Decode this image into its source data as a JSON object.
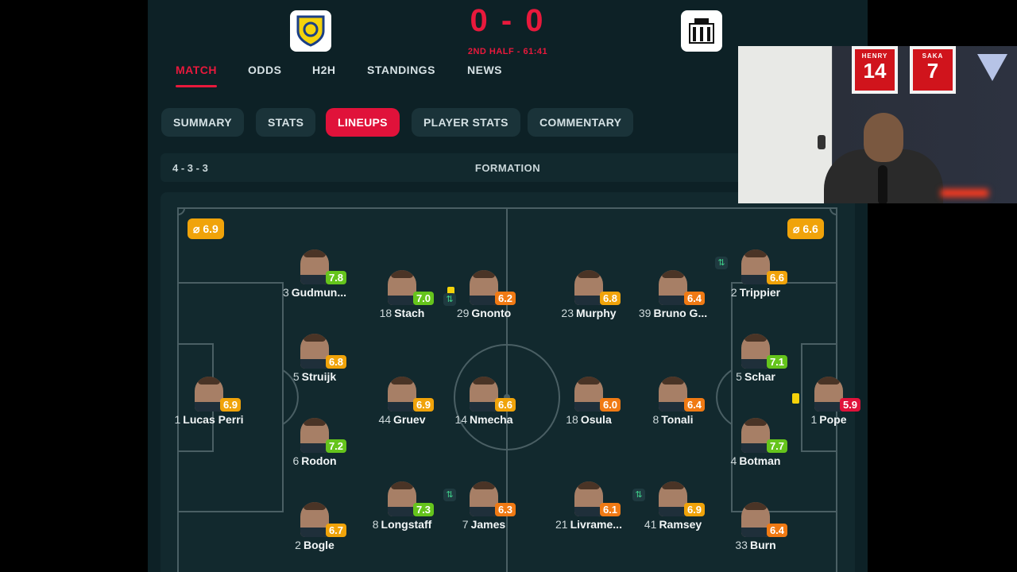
{
  "match": {
    "home_crest_icon": "leeds-united-crest-icon",
    "away_crest_icon": "newcastle-united-crest-icon",
    "score": "0 - 0",
    "status": "2ND HALF - 61:41"
  },
  "tabs": [
    "MATCH",
    "ODDS",
    "H2H",
    "STANDINGS",
    "NEWS"
  ],
  "active_tab": "MATCH",
  "subtabs": [
    "SUMMARY",
    "STATS",
    "LINEUPS",
    "PLAYER STATS",
    "COMMENTARY"
  ],
  "active_subtab": "LINEUPS",
  "formation": {
    "home": "4 - 3 - 3",
    "label": "FORMATION"
  },
  "avg_ratings": {
    "home": "⌀ 6.9",
    "away": "⌀ 6.6"
  },
  "rating_colors": {
    "green": "#65c41c",
    "orange": "#f0a30a",
    "deep_orange": "#f07a14",
    "red": "#e0123a"
  },
  "players": [
    {
      "num": "1",
      "name": "Lucas Perri",
      "rating": "6.9",
      "color": "orange"
    },
    {
      "num": "3",
      "name": "Gudmun...",
      "rating": "7.8",
      "color": "green"
    },
    {
      "num": "5",
      "name": "Struijk",
      "rating": "6.8",
      "color": "orange"
    },
    {
      "num": "6",
      "name": "Rodon",
      "rating": "7.2",
      "color": "green"
    },
    {
      "num": "2",
      "name": "Bogle",
      "rating": "6.7",
      "color": "orange"
    },
    {
      "num": "18",
      "name": "Stach",
      "rating": "7.0",
      "color": "green"
    },
    {
      "num": "44",
      "name": "Gruev",
      "rating": "6.9",
      "color": "orange"
    },
    {
      "num": "8",
      "name": "Longstaff",
      "rating": "7.3",
      "color": "green"
    },
    {
      "num": "29",
      "name": "Gnonto",
      "rating": "6.2",
      "color": "deep_orange",
      "yellow_card": true,
      "sub": true
    },
    {
      "num": "14",
      "name": "Nmecha",
      "rating": "6.6",
      "color": "orange"
    },
    {
      "num": "7",
      "name": "James",
      "rating": "6.3",
      "color": "deep_orange",
      "sub": true
    },
    {
      "num": "23",
      "name": "Murphy",
      "rating": "6.8",
      "color": "orange"
    },
    {
      "num": "18",
      "name": "Osula",
      "rating": "6.0",
      "color": "deep_orange"
    },
    {
      "num": "21",
      "name": "Livrame...",
      "rating": "6.1",
      "color": "deep_orange"
    },
    {
      "num": "39",
      "name": "Bruno G...",
      "rating": "6.4",
      "color": "deep_orange"
    },
    {
      "num": "8",
      "name": "Tonali",
      "rating": "6.4",
      "color": "deep_orange"
    },
    {
      "num": "41",
      "name": "Ramsey",
      "rating": "6.9",
      "color": "orange",
      "sub": true
    },
    {
      "num": "2",
      "name": "Trippier",
      "rating": "6.6",
      "color": "orange",
      "sub": true
    },
    {
      "num": "5",
      "name": "Schar",
      "rating": "7.1",
      "color": "green"
    },
    {
      "num": "4",
      "name": "Botman",
      "rating": "7.7",
      "color": "green"
    },
    {
      "num": "33",
      "name": "Burn",
      "rating": "6.4",
      "color": "deep_orange"
    },
    {
      "num": "1",
      "name": "Pope",
      "rating": "5.9",
      "color": "red",
      "yellow_card": true
    }
  ],
  "webcam": {
    "jerseys": [
      {
        "name": "HENRY",
        "number": "14"
      },
      {
        "name": "SAKA",
        "number": "7"
      }
    ],
    "logo_icon": "triangle-logo-icon"
  }
}
